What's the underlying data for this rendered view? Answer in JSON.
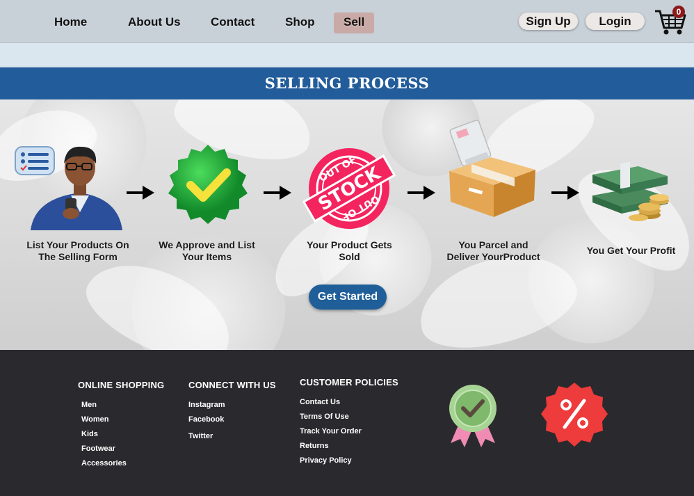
{
  "nav": {
    "items": [
      {
        "label": "Home"
      },
      {
        "label": "About Us"
      },
      {
        "label": "Contact"
      },
      {
        "label": "Shop"
      },
      {
        "label": "Sell",
        "active": true
      }
    ],
    "signup_label": "Sign Up",
    "login_label": "Login",
    "cart_count": "0"
  },
  "banner": {
    "title": "SELLING PROCESS"
  },
  "steps": [
    {
      "label": "List Your Products On The Selling Form",
      "icon": "seller-avatar-icon"
    },
    {
      "label": "We Approve and List Your Items",
      "icon": "approved-badge-icon"
    },
    {
      "label": "Your Product Gets Sold",
      "icon": "out-of-stock-stamp-icon"
    },
    {
      "label": "You Parcel and Deliver YourProduct",
      "icon": "parcel-box-icon"
    },
    {
      "label": "You Get Your Profit",
      "icon": "money-stack-icon"
    }
  ],
  "cta": {
    "label": "Get Started"
  },
  "footer": {
    "online_shopping": {
      "heading": "ONLINE SHOPPING",
      "links": [
        "Men",
        "Women",
        "Kids",
        "Footwear",
        "Accessories"
      ]
    },
    "connect": {
      "heading": "CONNECT WITH US",
      "links": [
        "Instagram",
        "Facebook",
        "Twitter"
      ]
    },
    "policies": {
      "heading": "CUSTOMER POLICIES",
      "links": [
        "Contact Us",
        "Terms Of Use",
        "Track Your Order",
        "Returns",
        "Privacy Policy"
      ]
    }
  },
  "colors": {
    "nav_bg": "#c8d0d8",
    "banner_bg": "#225c9a",
    "cta_bg": "#1f5e98",
    "footer_bg": "#2a2a2e",
    "active_nav": "#c9aaa6"
  }
}
